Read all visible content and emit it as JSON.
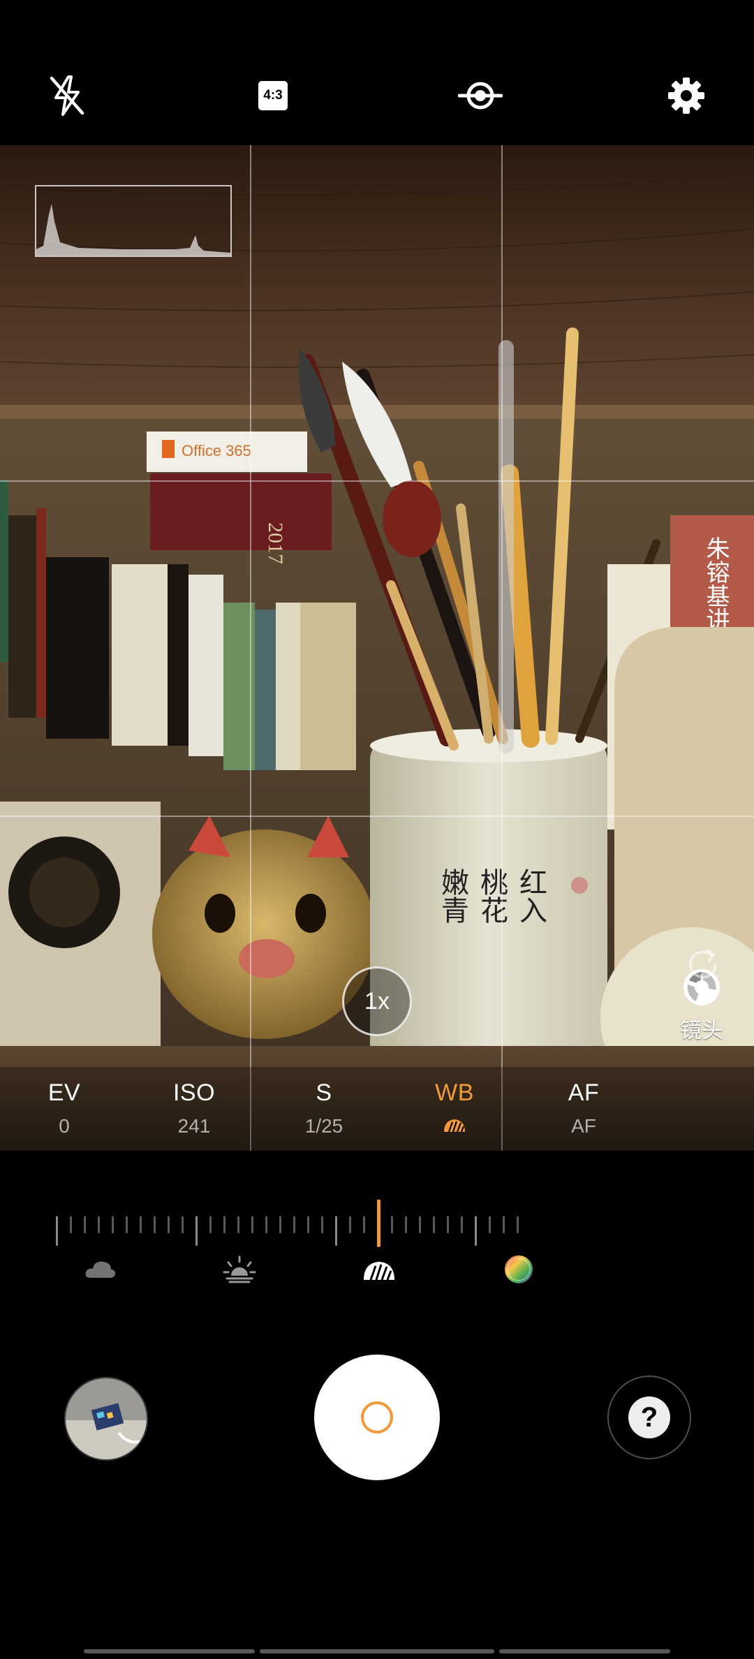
{
  "topbar": {
    "flash": {
      "icon": "flash-off-icon"
    },
    "ratio": {
      "label": "4:3",
      "icon": "aspect-ratio-icon"
    },
    "mode": {
      "icon": "stabilization-icon"
    },
    "settings": {
      "icon": "settings-gear-icon"
    }
  },
  "viewfinder": {
    "histogram_icon": "histogram",
    "zoom_label": "1x",
    "lens": {
      "icon": "lens-switch-icon",
      "label": "镜头"
    }
  },
  "params": [
    {
      "name": "EV",
      "value": "0"
    },
    {
      "name": "ISO",
      "value": "241"
    },
    {
      "name": "S",
      "value": "1/25"
    },
    {
      "name": "WB",
      "value_icon": "cloudy-wb-icon",
      "active": true
    },
    {
      "name": "AF",
      "value": "AF"
    }
  ],
  "reset_icon": "refresh-icon",
  "wb_slider": {
    "presets": [
      "cloudy-icon",
      "sunrise-icon",
      "shade-icon",
      "color-wheel-icon"
    ],
    "selected_preset": "shade-icon"
  },
  "bottom": {
    "gallery_icon": "gallery-thumbnail",
    "shutter_icon": "shutter-icon",
    "help_label": "?"
  },
  "colors": {
    "accent": "#f2993a",
    "background": "#000000"
  }
}
